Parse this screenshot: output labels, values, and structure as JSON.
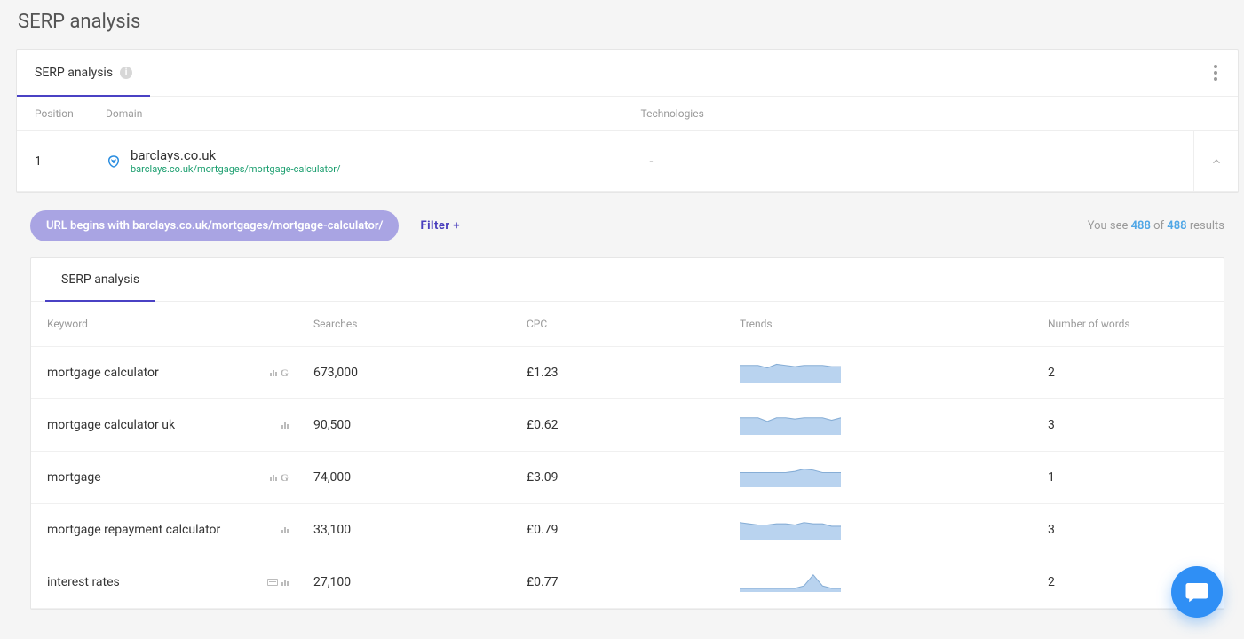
{
  "page": {
    "title": "SERP analysis"
  },
  "tabs": {
    "main": {
      "label": "SERP analysis"
    },
    "inner": {
      "label": "SERP analysis"
    }
  },
  "columns": {
    "position": "Position",
    "domain": "Domain",
    "technologies": "Technologies"
  },
  "result_row": {
    "position": "1",
    "domain": "barclays.co.uk",
    "url": "barclays.co.uk/mortgages/mortgage-calculator/",
    "technologies": "-"
  },
  "filter": {
    "pill": "URL begins with barclays.co.uk/mortgages/mortgage-calculator/",
    "add": "Filter +"
  },
  "result_count": {
    "prefix": "You see ",
    "shown": "488",
    "of": " of ",
    "total": "488",
    "suffix": " results"
  },
  "table": {
    "headers": {
      "keyword": "Keyword",
      "searches": "Searches",
      "cpc": "CPC",
      "trends": "Trends",
      "words": "Number of words"
    },
    "rows": [
      {
        "keyword": "mortgage calculator",
        "searches": "673,000",
        "cpc": "£1.23",
        "words": "2",
        "icons": "bars-g",
        "trend": [
          14,
          14,
          14,
          12,
          15,
          14,
          13,
          14,
          14,
          14,
          13,
          13
        ]
      },
      {
        "keyword": "mortgage calculator uk",
        "searches": "90,500",
        "cpc": "£0.62",
        "words": "3",
        "icons": "bars",
        "trend": [
          14,
          14,
          14,
          11,
          14,
          14,
          13,
          14,
          14,
          14,
          12,
          14
        ]
      },
      {
        "keyword": "mortgage",
        "searches": "74,000",
        "cpc": "£3.09",
        "words": "1",
        "icons": "bars-g",
        "trend": [
          12,
          12,
          12,
          12,
          12,
          12,
          13,
          15,
          14,
          12,
          12,
          12
        ]
      },
      {
        "keyword": "mortgage repayment calculator",
        "searches": "33,100",
        "cpc": "£0.79",
        "words": "3",
        "icons": "bars",
        "trend": [
          14,
          13,
          12,
          12,
          13,
          13,
          12,
          14,
          13,
          13,
          11,
          11
        ]
      },
      {
        "keyword": "interest rates",
        "searches": "27,100",
        "cpc": "£0.77",
        "words": "2",
        "icons": "card-bars",
        "trend": [
          3,
          3,
          3,
          3,
          3,
          3,
          3,
          5,
          14,
          5,
          3,
          3
        ]
      }
    ]
  },
  "icons": {
    "favicon_color": "#2a8de0",
    "spark_fill": "#b9d3ef",
    "spark_stroke": "#87aed6"
  }
}
